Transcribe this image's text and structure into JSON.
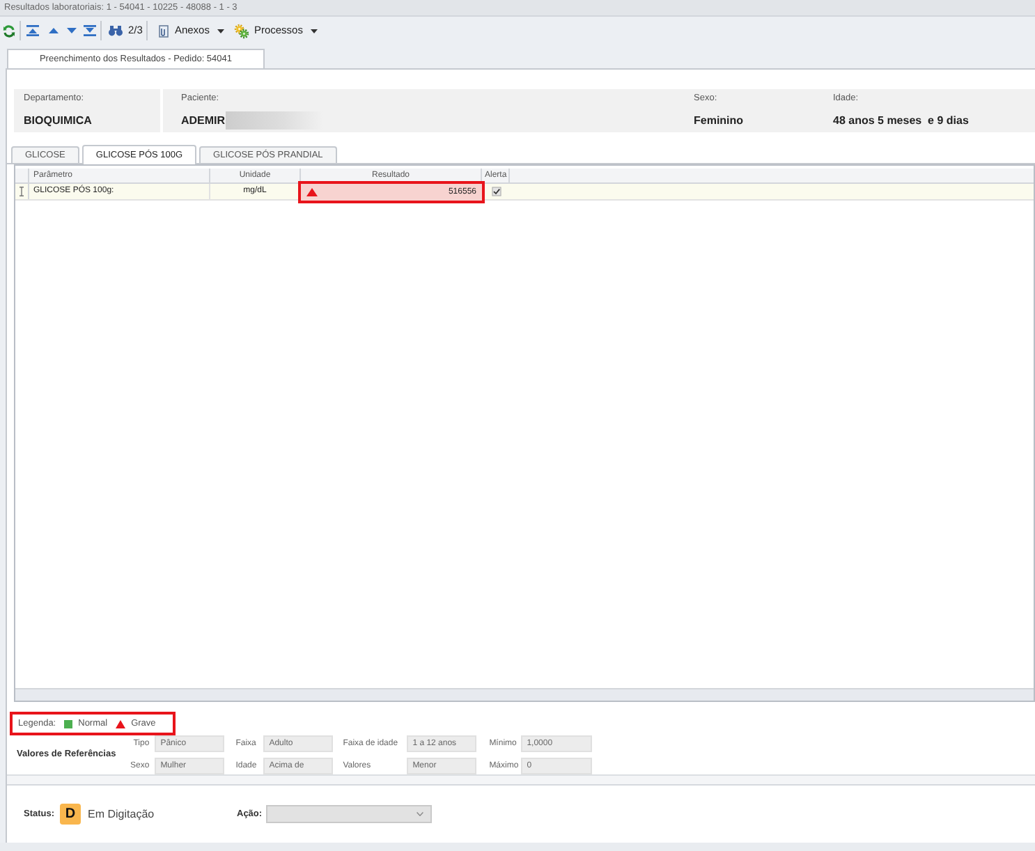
{
  "window": {
    "title": "Resultados laboratoriais: 1 - 54041 - 10225 - 48088 - 1 - 3"
  },
  "toolbar": {
    "counter": "2/3",
    "menus": [
      {
        "label": "Anexos"
      },
      {
        "label": "Processos"
      }
    ]
  },
  "document_tabs": [
    {
      "label": "Preenchimento dos Resultados - Pedido: 54041",
      "selected": true
    }
  ],
  "header_fields": [
    {
      "label": "Departamento:",
      "value": "BIOQUIMICA",
      "redacted": false
    },
    {
      "label": "Paciente:",
      "value": "ADEMIR",
      "redacted": true
    },
    {
      "label": "Sexo:",
      "value": "Feminino",
      "redacted": false
    },
    {
      "label": "Idade:",
      "value": "48 anos 5 meses  e 9 dias",
      "redacted": false
    }
  ],
  "exam_tabs": [
    {
      "label": "GLICOSE",
      "selected": false
    },
    {
      "label": "GLICOSE PÓS 100G",
      "selected": true
    },
    {
      "label": "GLICOSE PÓS PRANDIAL",
      "selected": false
    }
  ],
  "grid": {
    "columns": [
      "Parâmetro",
      "Unidade",
      "Resultado",
      "Alerta"
    ],
    "rows": [
      {
        "parameter": "GLICOSE PÓS 100g:",
        "unit": "mg/dL",
        "result": "516556",
        "critical": true,
        "alert": true,
        "editing": true
      }
    ]
  },
  "legend": {
    "label": "Legenda:",
    "items": [
      {
        "label": "Normal",
        "kind": "square",
        "color": "#4caf50"
      },
      {
        "label": "Grave",
        "kind": "triangle",
        "color": "#e8141b"
      }
    ]
  },
  "reference": {
    "title": "Valores de Referências",
    "fields": [
      {
        "label": "Tipo",
        "value": "Pânico"
      },
      {
        "label": "Faixa",
        "value": "Adulto"
      },
      {
        "label": "Faixa de idade",
        "value": "1 a 12 anos"
      },
      {
        "label": "Mínimo",
        "value": "1,0000"
      },
      {
        "label": "Sexo",
        "value": "Mulher"
      },
      {
        "label": "Idade",
        "value": "Acima de"
      },
      {
        "label": "Valores",
        "value": "Menor"
      },
      {
        "label": "Máximo",
        "value": "0"
      }
    ]
  },
  "status": {
    "label": "Status:",
    "badge": "D",
    "text": "Em Digitação"
  },
  "action": {
    "label": "Ação:",
    "disabled": true
  }
}
